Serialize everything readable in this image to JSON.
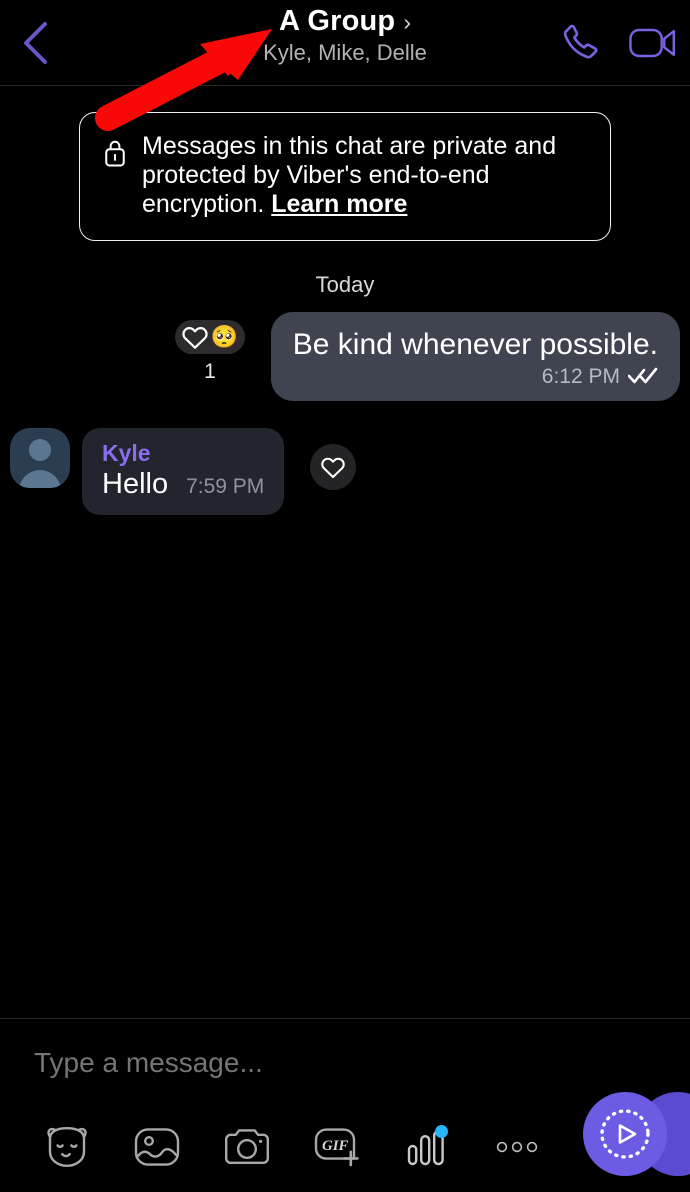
{
  "header": {
    "back_icon": "chevron-left-icon",
    "title": "A Group",
    "title_chevron": "›",
    "subtitle": "Kyle, Mike, Delle",
    "call_icon": "phone-icon",
    "video_icon": "video-camera-icon",
    "accent_color": "#7b61e0"
  },
  "encryption_notice": {
    "icon": "lock-icon",
    "text": "Messages in this chat are private and protected by Viber's end-to-end encryption. ",
    "link_label": "Learn more"
  },
  "conversation": {
    "day_separator": "Today",
    "messages": [
      {
        "direction": "outgoing",
        "text": "Be kind whenever possible.",
        "time": "6:12 PM",
        "status_icon": "double-check-icon",
        "reaction": {
          "heart_icon": "heart-outline-icon",
          "emoji": "🥺",
          "count": "1"
        }
      },
      {
        "direction": "incoming",
        "sender": "Kyle",
        "sender_color": "#8b6ef0",
        "text": "Hello",
        "time": "7:59 PM",
        "avatar_icon": "person-avatar-icon",
        "react_button_icon": "heart-outline-icon"
      }
    ]
  },
  "composer": {
    "placeholder": "Type a message...",
    "input_value": "",
    "tools": [
      {
        "name": "sticker-icon",
        "label": "sticker"
      },
      {
        "name": "gallery-icon",
        "label": "gallery"
      },
      {
        "name": "camera-icon",
        "label": "camera"
      },
      {
        "name": "gif-icon",
        "label": "GIF"
      },
      {
        "name": "voice-waveform-icon",
        "label": "voice",
        "badge": true
      },
      {
        "name": "more-options-icon",
        "label": "more"
      }
    ],
    "send_button": {
      "icon": "play-record-icon",
      "color": "#6c5ce4"
    }
  },
  "annotation": {
    "arrow_color": "#f90808",
    "points_to": "A Group"
  }
}
